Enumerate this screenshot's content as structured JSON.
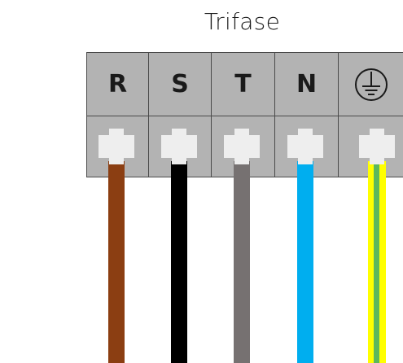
{
  "title": "Trifase",
  "terminals": [
    {
      "label": "R",
      "wire_color": "#8b3e12"
    },
    {
      "label": "S",
      "wire_color": "#000000"
    },
    {
      "label": "T",
      "wire_color": "#767171"
    },
    {
      "label": "N",
      "wire_color": "#00aeef"
    },
    {
      "label": "",
      "icon": "ground-icon",
      "wire_color": "#ffff00",
      "wire_stripe_color": "#5cb85c"
    }
  ],
  "colors": {
    "block_fill": "#b3b3b3",
    "block_border": "#4a4a4a",
    "screw": "#eeeeee"
  }
}
